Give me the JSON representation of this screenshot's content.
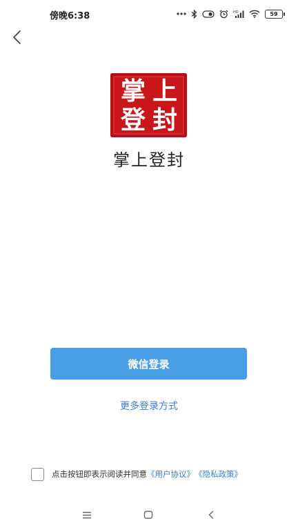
{
  "status_bar": {
    "time": "傍晚6:38",
    "battery": "59",
    "icons": [
      "more-dots-icon",
      "bluetooth-icon",
      "vibrate-icon",
      "alarm-icon",
      "hd-signal-icon",
      "wifi-icon",
      "battery-icon"
    ]
  },
  "nav": {
    "back_icon": "chevron-left-icon"
  },
  "logo": {
    "seal_chars": [
      "掌",
      "上",
      "登",
      "封"
    ]
  },
  "app_name": "掌上登封",
  "login": {
    "wechat_label": "微信登录",
    "more_label": "更多登录方式"
  },
  "agreement": {
    "checked": false,
    "text": "点击按钮即表示阅读并同意",
    "user_agreement": "《用户协议》",
    "privacy_policy": "《隐私政策》"
  },
  "system_nav": {
    "icons": [
      "menu-icon",
      "home-icon",
      "back-icon"
    ]
  },
  "colors": {
    "primary_button": "#4a9ee6",
    "link": "#3d7fc4",
    "seal_red": "#c9161b"
  }
}
